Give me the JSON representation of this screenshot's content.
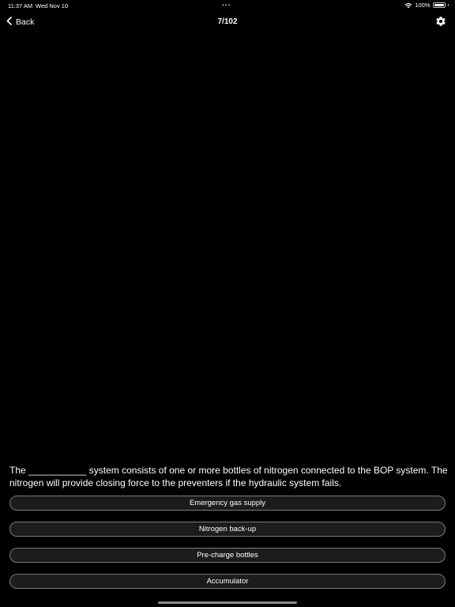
{
  "status_bar": {
    "time": "11:37 AM",
    "date": "Wed Nov 10",
    "dots": "•••",
    "battery_percent": "100%",
    "battery_level": 1.0
  },
  "nav": {
    "back_label": "Back",
    "title": "7/102"
  },
  "question": {
    "text": "The ___________ system consists of one or more bottles of nitrogen connected to the BOP system. The nitrogen will provide closing force to the preventers if the hydraulic system fails."
  },
  "answers": [
    {
      "label": "Emergency gas supply"
    },
    {
      "label": "Nitrogen back-up"
    },
    {
      "label": "Pre-charge bottles"
    },
    {
      "label": "Accumulator"
    }
  ],
  "icons": {
    "back": "chevron-left-icon",
    "settings": "gear-icon",
    "wifi": "wifi-icon",
    "battery": "battery-icon"
  },
  "colors": {
    "background": "#000000",
    "button_fill": "#1c1c1e",
    "button_border": "#7a7a7a",
    "text": "#ffffff"
  }
}
